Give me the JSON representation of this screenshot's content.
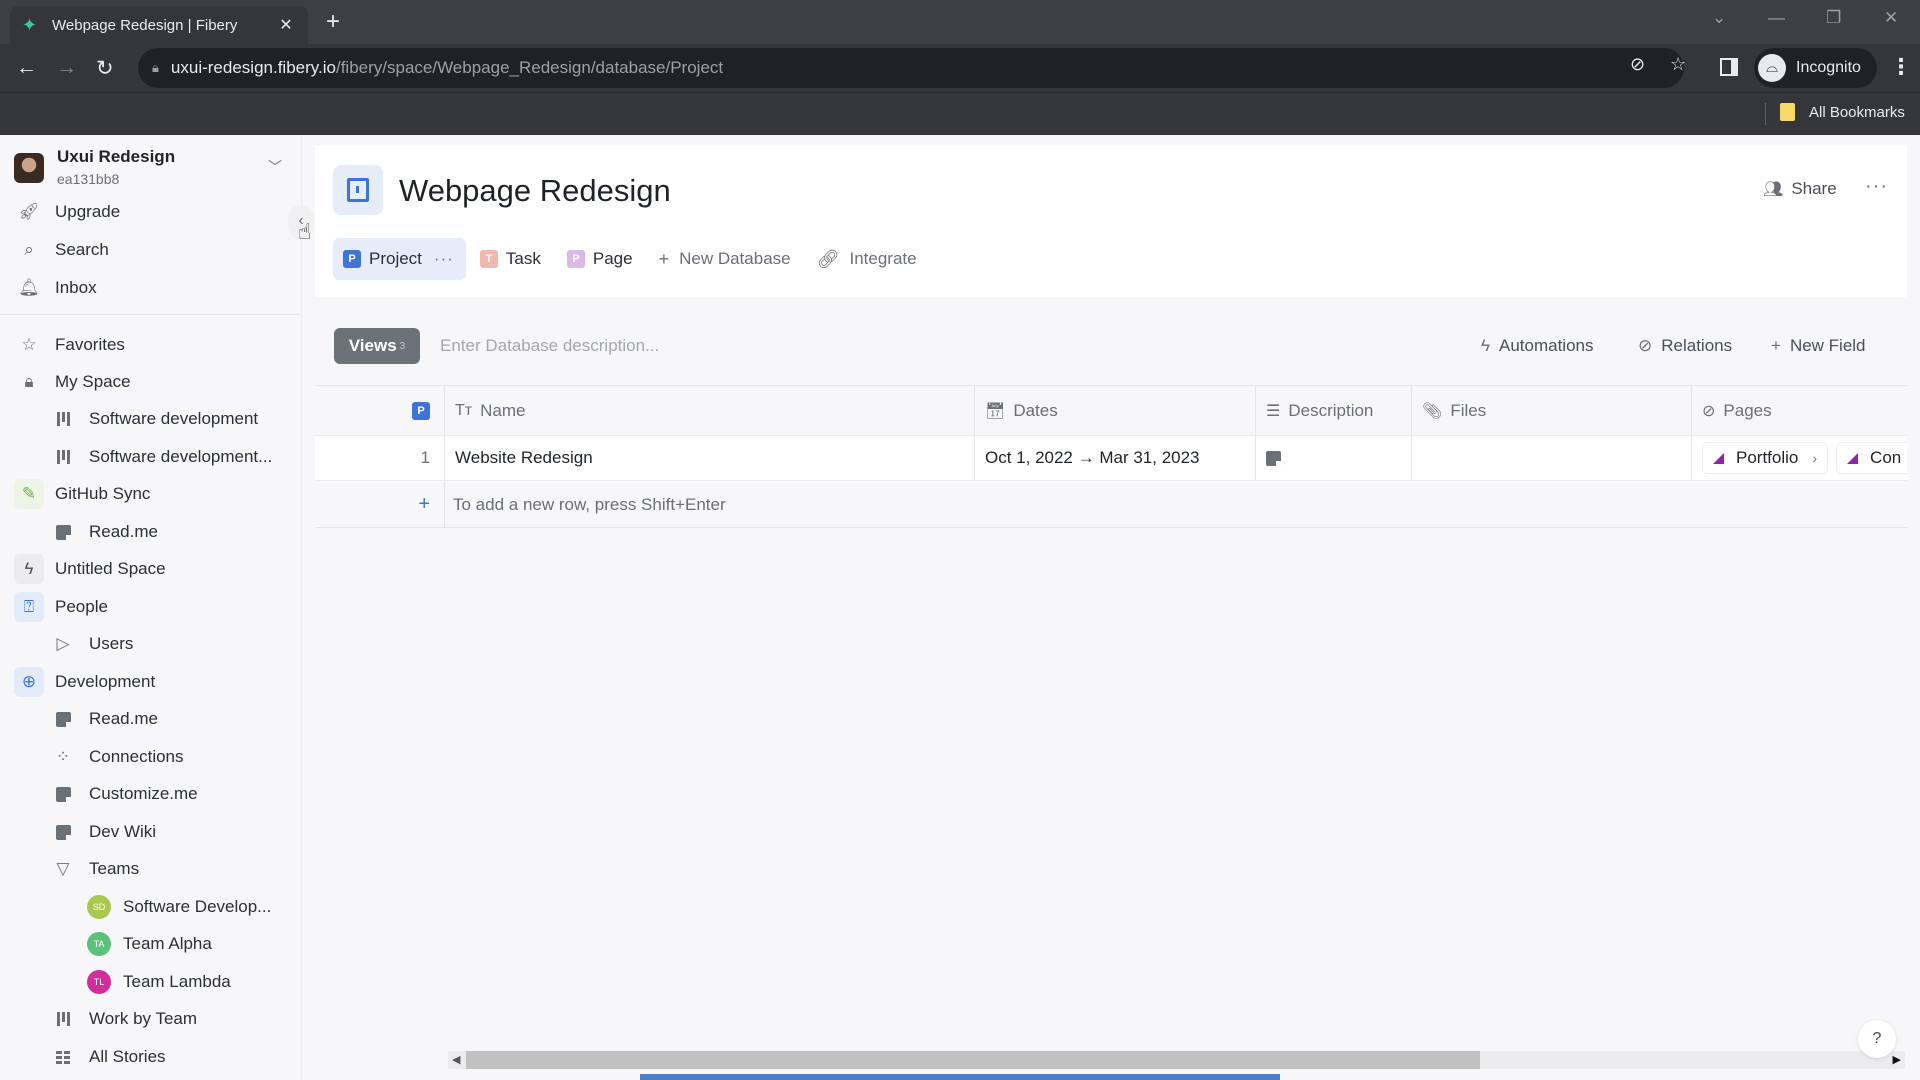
{
  "browser": {
    "tab_title": "Webpage Redesign | Fibery",
    "url_host": "uxui-redesign.fibery.io",
    "url_path": "/fibery/space/Webpage_Redesign/database/Project",
    "profile_label": "Incognito",
    "bookmarks_label": "All Bookmarks",
    "icons": [
      "fibery-favicon",
      "close-icon",
      "plus-icon",
      "back-icon",
      "forward-icon",
      "reload-icon",
      "lock-icon",
      "eye-off-icon",
      "star-icon",
      "side-panel-icon",
      "incognito-icon",
      "more-vertical-icon",
      "folder-icon"
    ]
  },
  "workspace": {
    "name": "Uxui Redesign",
    "id": "ea131bb8"
  },
  "sidebar": {
    "top_items": [
      {
        "label": "Upgrade",
        "icon": "rocket-icon"
      },
      {
        "label": "Search",
        "icon": "search-icon"
      },
      {
        "label": "Inbox",
        "icon": "bell-icon"
      }
    ],
    "items": [
      {
        "label": "Favorites",
        "icon": "star-icon",
        "level": 0
      },
      {
        "label": "My Space",
        "icon": "lock-icon",
        "level": 0
      },
      {
        "label": "Software development",
        "icon": "board-icon",
        "level": 1
      },
      {
        "label": "Software development...",
        "icon": "board-icon",
        "level": 1
      },
      {
        "label": "GitHub Sync",
        "icon": "github-sync-space-icon",
        "level": 0
      },
      {
        "label": "Read.me",
        "icon": "document-icon",
        "level": 1
      },
      {
        "label": "Untitled Space",
        "icon": "lightning-space-icon",
        "level": 0
      },
      {
        "label": "People",
        "icon": "people-space-icon",
        "level": 0
      },
      {
        "label": "Users",
        "icon": "triangle-right-icon",
        "level": 1
      },
      {
        "label": "Development",
        "icon": "development-space-icon",
        "level": 0
      },
      {
        "label": "Read.me",
        "icon": "document-icon",
        "level": 1
      },
      {
        "label": "Connections",
        "icon": "connections-icon",
        "level": 1
      },
      {
        "label": "Customize.me",
        "icon": "document-icon",
        "level": 1
      },
      {
        "label": "Dev Wiki",
        "icon": "document-icon",
        "level": 1
      },
      {
        "label": "Teams",
        "icon": "triangle-down-icon",
        "level": 1
      },
      {
        "label": "Software Develop...",
        "badge": "SD",
        "badge_color": "#a7c94d",
        "level": 2
      },
      {
        "label": "Team Alpha",
        "badge": "TA",
        "badge_color": "#5cc17a",
        "level": 2
      },
      {
        "label": "Team Lambda",
        "badge": "TL",
        "badge_color": "#d02d9d",
        "level": 2
      },
      {
        "label": "Work by Team",
        "icon": "board-icon",
        "level": 1
      },
      {
        "label": "All Stories",
        "icon": "list-grid-icon",
        "level": 1
      }
    ]
  },
  "header": {
    "title": "Webpage Redesign",
    "share_label": "Share",
    "more_label": "···"
  },
  "db_tabs": [
    {
      "label": "Project",
      "chip": "P",
      "chip_color": "#3e74d6",
      "active": true,
      "more": "···"
    },
    {
      "label": "Task",
      "chip": "T",
      "chip_color": "#f3b7ad"
    },
    {
      "label": "Page",
      "chip": "P",
      "chip_color": "#d9b9e9"
    },
    {
      "label": "New Database",
      "icon": "+"
    },
    {
      "label": "Integrate",
      "icon": "link-icon"
    }
  ],
  "toolbar": {
    "views_label": "Views",
    "views_count": "3",
    "description_placeholder": "Enter Database description...",
    "automations_label": "Automations",
    "relations_label": "Relations",
    "new_field_label": "New Field"
  },
  "table": {
    "type_chip": "P",
    "columns": [
      {
        "label": "Name",
        "icon": "text-icon"
      },
      {
        "label": "Dates",
        "icon": "calendar-icon"
      },
      {
        "label": "Description",
        "icon": "rich-text-icon"
      },
      {
        "label": "Files",
        "icon": "paperclip-icon"
      },
      {
        "label": "Pages",
        "icon": "relation-icon"
      }
    ],
    "rows": [
      {
        "index": "1",
        "name": "Website Redesign",
        "dates": "Oct 1, 2022 → Mar 31, 2023",
        "description_icon": "document-icon",
        "files": "",
        "pages": [
          "Portfolio",
          "Con"
        ]
      }
    ],
    "add_row_hint": "To add a new row, press Shift+Enter"
  },
  "help_label": "?"
}
